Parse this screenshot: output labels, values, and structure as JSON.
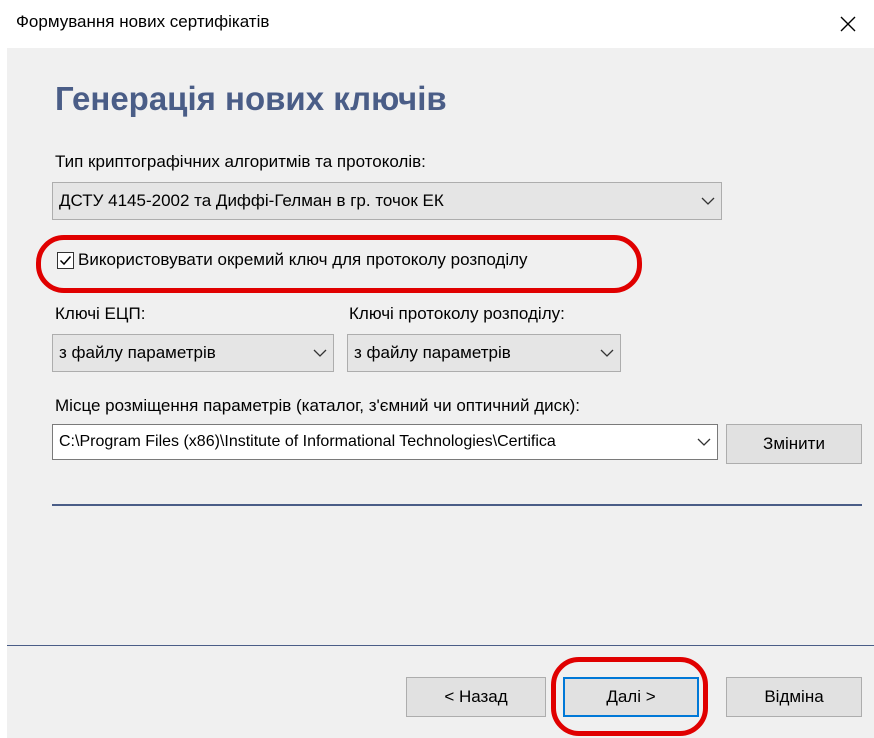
{
  "window": {
    "title": "Формування нових сертифікатів",
    "close_icon": "close-icon"
  },
  "page": {
    "heading": "Генерація нових ключів",
    "algo": {
      "label": "Тип криптографічних алгоритмів та протоколів:",
      "value": "ДСТУ 4145-2002 та Диффі-Гелман в гр. точок ЕК"
    },
    "separate_key": {
      "label": "Використовувати окремий ключ для протоколу розподілу",
      "checked": true
    },
    "keys_eds": {
      "label": "Ключі ЕЦП:",
      "value": "з файлу параметрів"
    },
    "keys_distribution": {
      "label": "Ключі протоколу розподілу:",
      "value": "з файлу параметрів"
    },
    "params_location": {
      "label": "Місце розміщення параметрів (каталог, з'ємний чи оптичний диск):",
      "value": "C:\\Program Files (x86)\\Institute of Informational Technologies\\Certifica",
      "change_label": "Змінити"
    }
  },
  "footer": {
    "back_label": "< Назад",
    "next_label": "Далі >",
    "cancel_label": "Відміна"
  },
  "colors": {
    "accent": "#4a5d87",
    "highlight": "#e00000",
    "background": "#f0f0f0"
  }
}
